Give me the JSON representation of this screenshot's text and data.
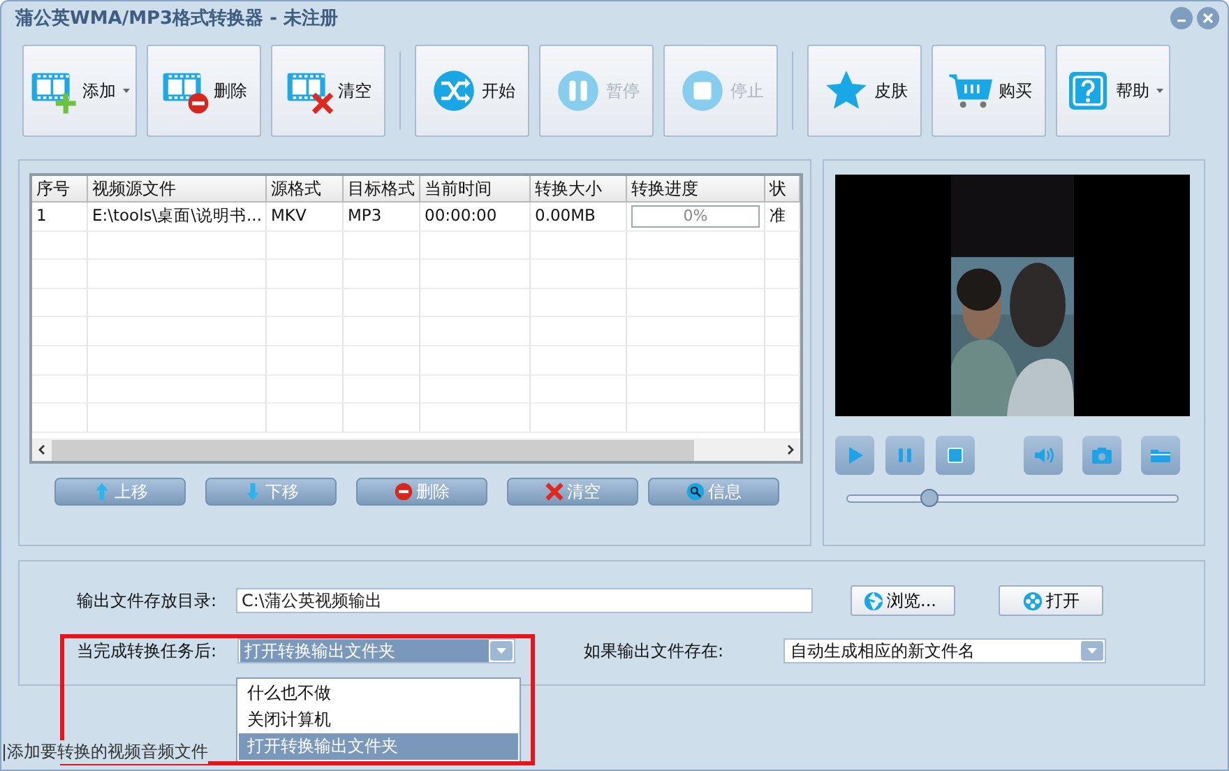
{
  "window": {
    "title": "蒲公英WMA/MP3格式转换器 - 未注册"
  },
  "toolbar": {
    "groups": [
      [
        {
          "kind": "add",
          "label": "添加",
          "disabled": false,
          "menu": true
        },
        {
          "kind": "remove",
          "label": "删除",
          "disabled": false,
          "menu": false
        },
        {
          "kind": "clear",
          "label": "清空",
          "disabled": false,
          "menu": false
        }
      ],
      [
        {
          "kind": "start",
          "label": "开始",
          "disabled": false,
          "menu": false
        },
        {
          "kind": "pause",
          "label": "暂停",
          "disabled": true,
          "menu": false
        },
        {
          "kind": "stop",
          "label": "停止",
          "disabled": true,
          "menu": false
        }
      ],
      [
        {
          "kind": "skin",
          "label": "皮肤",
          "disabled": false,
          "menu": false
        },
        {
          "kind": "buy",
          "label": "购买",
          "disabled": false,
          "menu": false
        },
        {
          "kind": "help",
          "label": "帮助",
          "disabled": false,
          "menu": true
        }
      ]
    ]
  },
  "table": {
    "columns": [
      "序号",
      "视频源文件",
      "源格式",
      "目标格式",
      "当前时间",
      "转换大小",
      "转换进度",
      "状"
    ],
    "rows": [
      {
        "cells": [
          "1",
          "E:\\tools\\桌面\\说明书...",
          "MKV",
          "MP3",
          "00:00:00",
          "0.00MB"
        ],
        "progress": {
          "level": 0,
          "text": "0%"
        },
        "status": "准"
      }
    ]
  },
  "list_buttons": [
    {
      "kind": "up",
      "label": "上移"
    },
    {
      "kind": "down",
      "label": "下移"
    },
    {
      "kind": "remove",
      "label": "删除"
    },
    {
      "kind": "clear",
      "label": "清空"
    },
    {
      "kind": "info",
      "label": "信息"
    }
  ],
  "player": {
    "seek": {
      "level": 0.25
    }
  },
  "output": {
    "label": "输出文件存放目录:",
    "path": "C:\\蒲公英视频输出",
    "buttons": [
      {
        "kind": "browse",
        "label": "浏览..."
      },
      {
        "kind": "open",
        "label": "打开"
      }
    ]
  },
  "after_complete": {
    "label": "当完成转换任务后:",
    "value": "打开转换输出文件夹",
    "expanded": true,
    "options": [
      {
        "label": "什么也不做",
        "selected": false
      },
      {
        "label": "关闭计算机",
        "selected": false
      },
      {
        "label": "打开转换输出文件夹",
        "selected": true
      }
    ]
  },
  "if_exists": {
    "label": "如果输出文件存在:",
    "value": "自动生成相应的新文件名"
  },
  "status_bar": {
    "text": "|添加要转换的视频音频文件"
  }
}
